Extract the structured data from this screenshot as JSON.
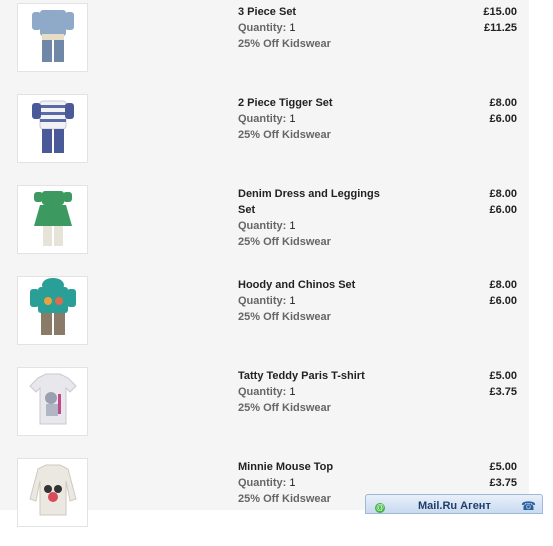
{
  "items": [
    {
      "name_lines": [
        "3 Piece Set"
      ],
      "quantity_label": "Quantity:",
      "quantity": "1",
      "promo": "25% Off Kidswear",
      "price_original": "£15.00",
      "price_discounted": "£11.25",
      "thumb_icon": "baby-outfit-blue-cardigan-icon"
    },
    {
      "name_lines": [
        "2 Piece Tigger Set"
      ],
      "quantity_label": "Quantity:",
      "quantity": "1",
      "promo": "25% Off Kidswear",
      "price_original": "£8.00",
      "price_discounted": "£6.00",
      "thumb_icon": "baby-outfit-striped-tigger-icon"
    },
    {
      "name_lines": [
        "Denim Dress and Leggings",
        "Set"
      ],
      "quantity_label": "Quantity:",
      "quantity": "1",
      "promo": "25% Off Kidswear",
      "price_original": "£8.00",
      "price_discounted": "£6.00",
      "thumb_icon": "baby-outfit-green-dress-icon"
    },
    {
      "name_lines": [
        "Hoody and Chinos Set"
      ],
      "quantity_label": "Quantity:",
      "quantity": "1",
      "promo": "25% Off Kidswear",
      "price_original": "£8.00",
      "price_discounted": "£6.00",
      "thumb_icon": "baby-outfit-teal-hoody-icon"
    },
    {
      "name_lines": [
        "Tatty Teddy Paris T-shirt"
      ],
      "quantity_label": "Quantity:",
      "quantity": "1",
      "promo": "25% Off Kidswear",
      "price_original": "£5.00",
      "price_discounted": "£3.75",
      "thumb_icon": "baby-tshirt-teddy-icon"
    },
    {
      "name_lines": [
        "Minnie Mouse Top"
      ],
      "quantity_label": "Quantity:",
      "quantity": "1",
      "promo": "25% Off Kidswear",
      "price_original": "£5.00",
      "price_discounted": "£3.75",
      "thumb_icon": "baby-top-minnie-icon"
    }
  ],
  "agent": {
    "label": "Mail.Ru Агент",
    "icon": "mailru-agent-icon",
    "phone_icon": "phone-icon"
  },
  "colors": {
    "panel_bg": "#f5f5f5",
    "text_dark": "#222222",
    "text_grey": "#666666"
  }
}
